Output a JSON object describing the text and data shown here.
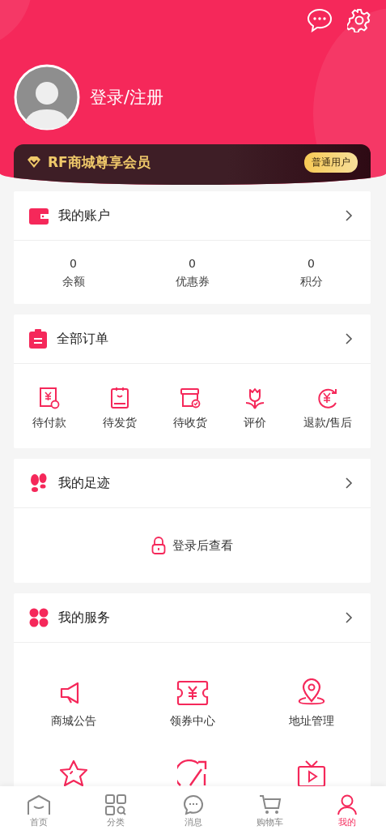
{
  "header": {
    "login_label": "登录/注册",
    "member": {
      "title": "RF商城尊享会员",
      "badge": "普通用户"
    }
  },
  "account": {
    "title": "我的账户",
    "stats": [
      {
        "value": "0",
        "label": "余额"
      },
      {
        "value": "0",
        "label": "优惠券"
      },
      {
        "value": "0",
        "label": "积分"
      }
    ]
  },
  "orders": {
    "title": "全部订单",
    "items": [
      {
        "kind": "pay",
        "label": "待付款"
      },
      {
        "kind": "ship",
        "label": "待发货"
      },
      {
        "kind": "receive",
        "label": "待收货"
      },
      {
        "kind": "review",
        "label": "评价"
      },
      {
        "kind": "refund",
        "label": "退款/售后"
      }
    ]
  },
  "footprint": {
    "title": "我的足迹",
    "login_hint": "登录后查看"
  },
  "services": {
    "title": "我的服务",
    "items": [
      {
        "kind": "notice",
        "label": "商城公告"
      },
      {
        "kind": "coupon",
        "label": "领券中心"
      },
      {
        "kind": "address",
        "label": "地址管理"
      },
      {
        "kind": "favorite"
      },
      {
        "kind": "speed"
      },
      {
        "kind": "video"
      }
    ]
  },
  "tab_bar": [
    {
      "kind": "home",
      "label": "首页",
      "selected": false
    },
    {
      "kind": "category",
      "label": "分类",
      "selected": false
    },
    {
      "kind": "message",
      "label": "消息",
      "selected": false
    },
    {
      "kind": "cart",
      "label": "购物车",
      "selected": false
    },
    {
      "kind": "user",
      "label": "我的",
      "selected": true
    }
  ]
}
